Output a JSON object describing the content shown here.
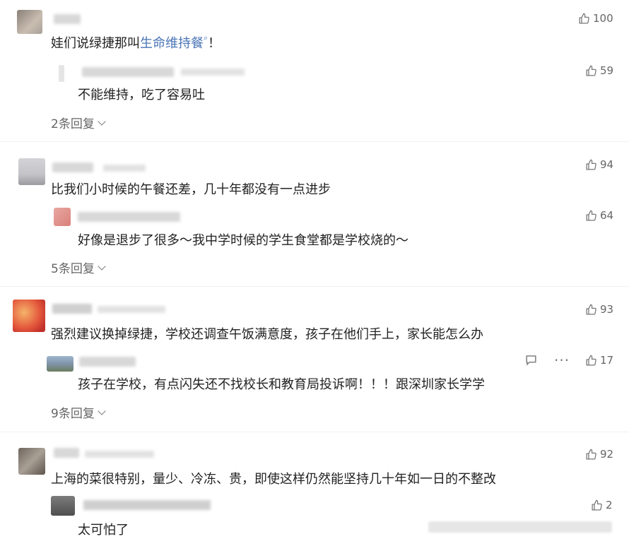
{
  "comments": [
    {
      "text_plain": "娃们说绿捷那叫",
      "text_link": "生命维持餐",
      "text_suffix": "！",
      "likes": "100",
      "reply": {
        "text": "不能维持，吃了容易吐",
        "likes": "59"
      },
      "expand_label": "2条回复"
    },
    {
      "text": "比我们小时候的午餐还差，几十年都没有一点进步",
      "likes": "94",
      "reply": {
        "text": "好像是退步了很多～我中学时候的学生食堂都是学校烧的～",
        "likes": "64"
      },
      "expand_label": "5条回复"
    },
    {
      "text": "强烈建议换掉绿捷，学校还调查午饭满意度，孩子在他们手上，家长能怎么办",
      "likes": "93",
      "reply": {
        "text": "孩子在学校，有点闪失还不找校长和教育局投诉啊！！！跟深圳家长学学",
        "likes": "17"
      },
      "expand_label": "9条回复"
    },
    {
      "text": "上海的菜很特别，量少、冷冻、贵，即使这样仍然能坚持几十年如一日的不整改",
      "likes": "92",
      "reply": {
        "text": "太可怕了",
        "likes": "2"
      }
    }
  ],
  "icons": {
    "like": "thumbs-up-icon",
    "chevron": "chevron-down-icon",
    "comment": "comment-icon",
    "more": "more-dots-icon",
    "search": "search-icon"
  },
  "colors": {
    "link": "#4a74b6",
    "text": "#222222",
    "muted": "#666666"
  }
}
